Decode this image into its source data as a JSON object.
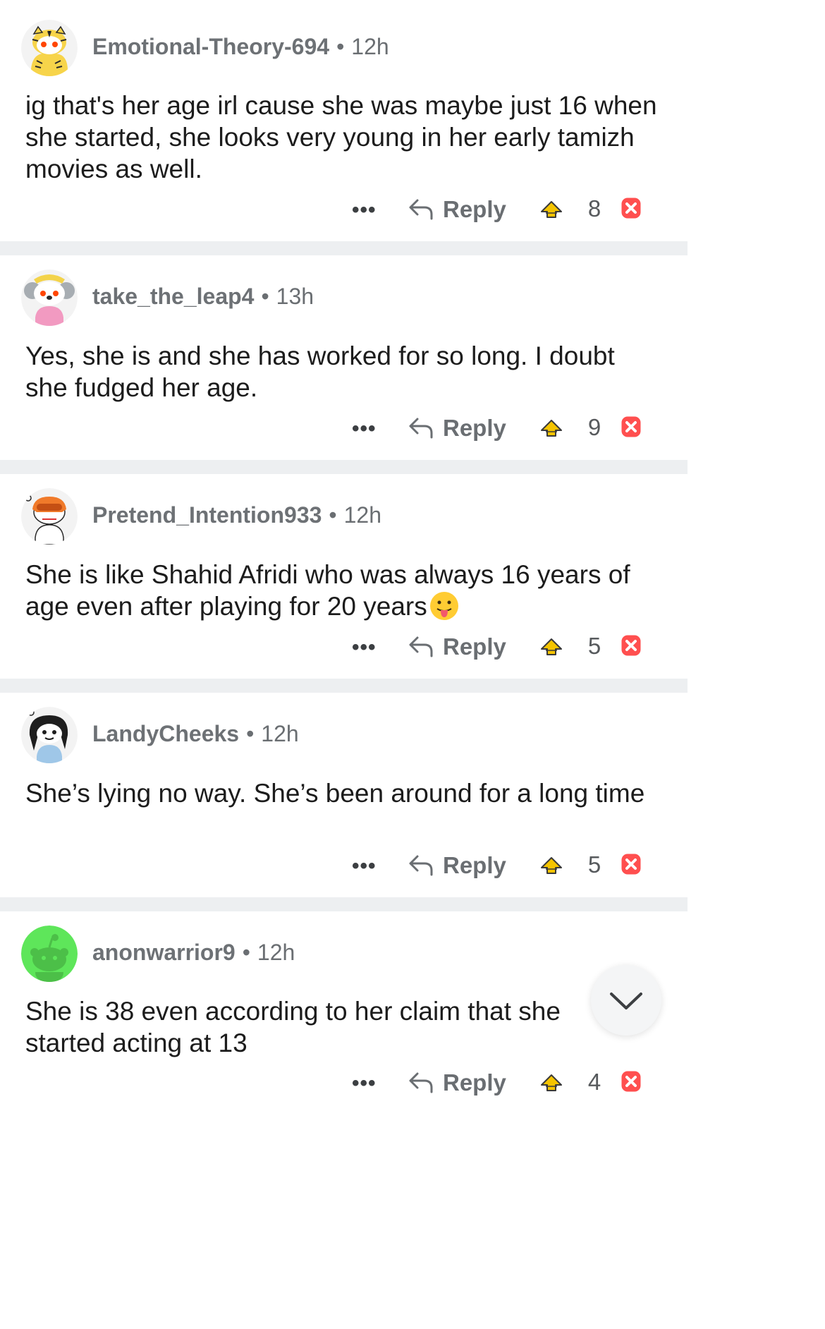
{
  "comments": [
    {
      "username": "Emotional-Theory-694",
      "time": "12h",
      "text": "ig that's her age irl cause she was maybe just 16 when she started, she looks very young in her early tamizh movies as well.",
      "more_label": "•••",
      "reply_label": "Reply",
      "score": "8",
      "avatar_icon": "tiger-snoo-avatar-icon"
    },
    {
      "username": "take_the_leap4",
      "time": "13h",
      "text": "Yes, she is and she has worked for so long. I doubt she fudged her age.",
      "more_label": "•••",
      "reply_label": "Reply",
      "score": "9",
      "avatar_icon": "koala-snoo-avatar-icon"
    },
    {
      "username": "Pretend_Intention933",
      "time": "12h",
      "text": "She is like Shahid Afridi who was always 16 years of age even after playing for 20 years",
      "emoji": "tongue-out-emoji-icon",
      "more_label": "•••",
      "reply_label": "Reply",
      "score": "5",
      "avatar_icon": "goggles-snoo-avatar-icon"
    },
    {
      "username": "LandyCheeks",
      "time": "12h",
      "text": "She’s lying no way. She’s been around for a long time",
      "more_label": "•••",
      "reply_label": "Reply",
      "score": "5",
      "avatar_icon": "dark-hair-snoo-avatar-icon"
    },
    {
      "username": "anonwarrior9",
      "time": "12h",
      "text": "She is 38 even according to her claim that she started acting at 13",
      "more_label": "•••",
      "reply_label": "Reply",
      "score": "4",
      "avatar_icon": "default-green-snoo-avatar-icon"
    }
  ],
  "separator": "•",
  "colors": {
    "divider": "#edeff1",
    "meta_text": "#6a6e72",
    "body_text": "#1c1c1c",
    "upvote_fill": "#f5c400",
    "downvote_fill": "#ff4f4f",
    "default_avatar_bg": "#5ee65a"
  },
  "scroll_button_icon": "chevron-down-icon"
}
